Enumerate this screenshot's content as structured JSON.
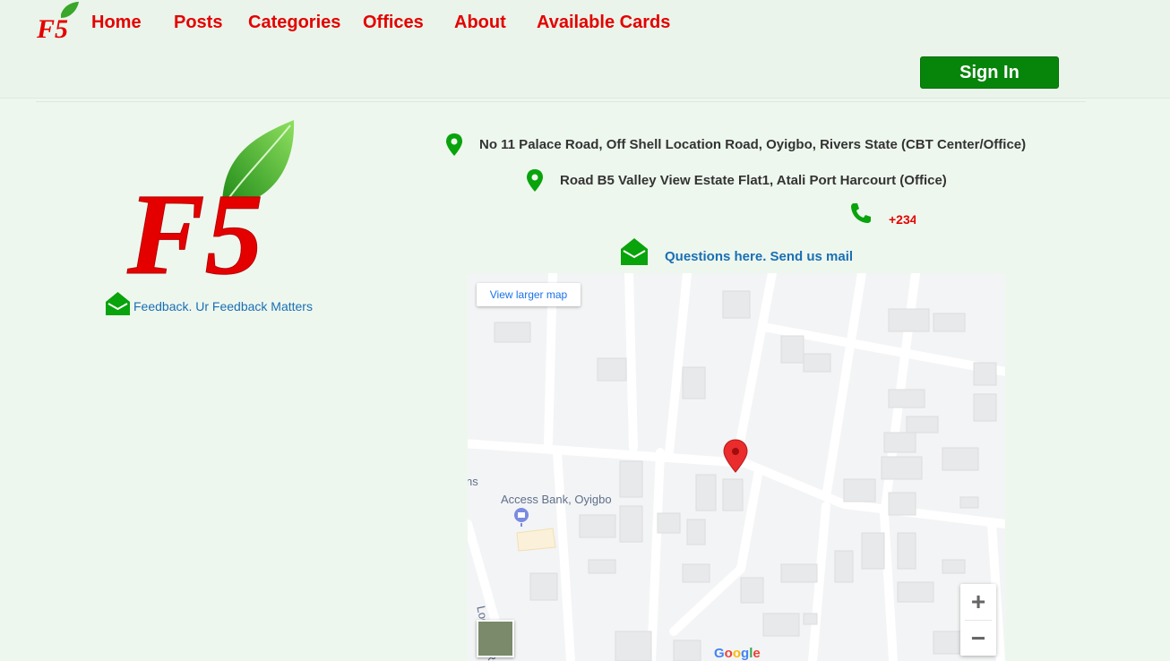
{
  "nav": {
    "links": [
      "Home",
      "Posts",
      "Categories",
      "Offices",
      "About",
      "Available Cards"
    ],
    "signin_label": "Sign In"
  },
  "logo": {
    "text": "F5"
  },
  "feedback": {
    "label": "Feedback. Ur Feedback Matters"
  },
  "contact": {
    "address1": "No 11 Palace Road, Off Shell Location Road, Oyigbo, Rivers State (CBT Center/Office)",
    "address2": "Road B5 Valley View Estate Flat1, Atali Port Harcourt (Office)",
    "phone": "+234",
    "mail_label": "Questions here. Send us mail"
  },
  "map": {
    "larger_map_label": "View larger map",
    "poi_label": "Access Bank, Oyigbo",
    "edge_label": "ns",
    "road_label": "Location Rd",
    "brand": "Google"
  },
  "colors": {
    "brand_red": "#e50000",
    "green": "#07850b",
    "link_blue": "#1a6fb5"
  }
}
